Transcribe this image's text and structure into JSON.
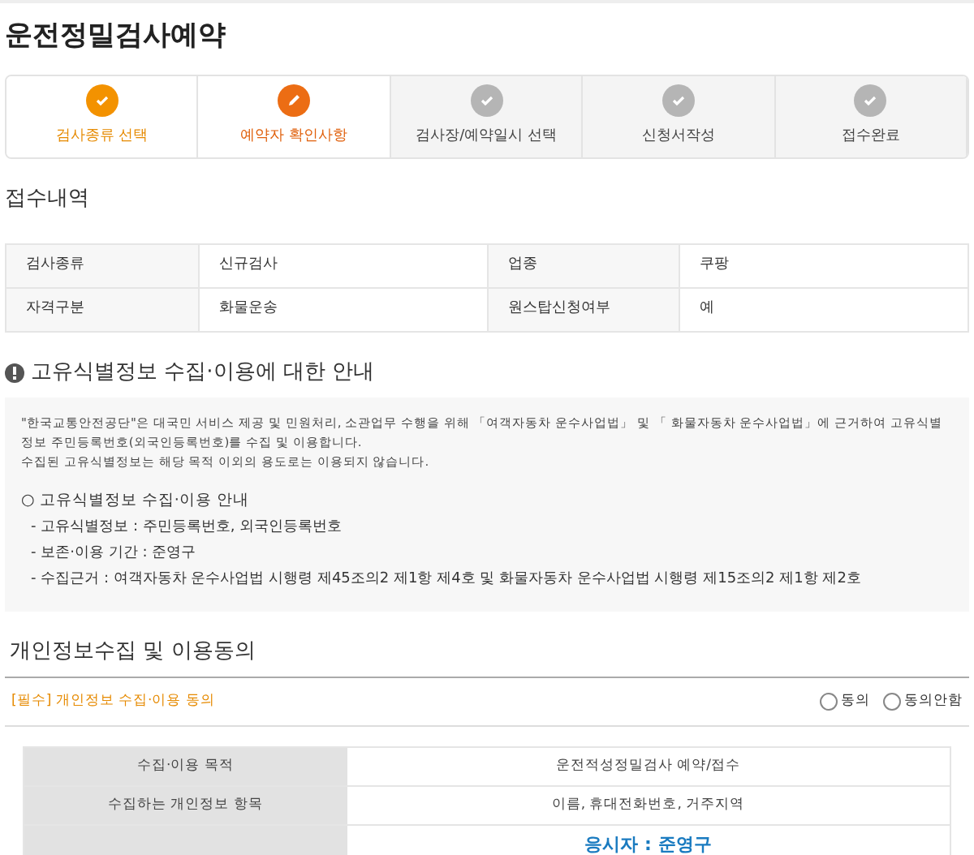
{
  "title": "운전정밀검사예약",
  "steps": [
    {
      "label": "검사종류 선택",
      "done": true,
      "selected": false
    },
    {
      "label": "예약자 확인사항",
      "done": false,
      "selected": true
    },
    {
      "label": "검사장/예약일시 선택",
      "done": false,
      "selected": false
    },
    {
      "label": "신청서작성",
      "done": false,
      "selected": false
    },
    {
      "label": "접수완료",
      "done": false,
      "selected": false
    }
  ],
  "receipt": {
    "heading": "접수내역",
    "rows": [
      [
        "검사종류",
        "신규검사",
        "업종",
        "쿠팡"
      ],
      [
        "자격구분",
        "화물운송",
        "원스탑신청여부",
        "예"
      ]
    ]
  },
  "notice": {
    "heading": "고유식별정보 수집·이용에 대한 안내",
    "paragraphs": [
      "\"한국교통안전공단\"은 대국민 서비스 제공 및 민원처리, 소관업무 수행을 위해 「여객자동차 운수사업법」 및 「 화물자동차 운수사업법」에 근거하여 고유식별정보 주민등록번호(외국인등록번호)를 수집 및 이용합니다.",
      "수집된 고유식별정보는 해당 목적 이외의 용도로는 이용되지 않습니다."
    ],
    "list_title": "○ 고유식별정보 수집·이용 안내",
    "items": [
      "- 고유식별정보 : 주민등록번호, 외국인등록번호",
      "- 보존·이용 기간 : 준영구",
      "- 수집근거 : 여객자동차 운수사업법 시행령 제45조의2 제1항 제4호 및 화물자동차 운수사업법 시행령 제15조의2 제1항 제2호"
    ]
  },
  "consent": {
    "heading": "개인정보수집 및 이용동의",
    "required_label": "[필수] 개인정보 수집·이용 동의",
    "options": [
      {
        "label": "동의",
        "selected": false
      },
      {
        "label": "동의안함",
        "selected": false
      }
    ],
    "rows": [
      {
        "label": "수집·이용 목적",
        "values": [
          "운전적성정밀검사 예약/접수"
        ],
        "emphasis": false
      },
      {
        "label": "수집하는 개인정보 항목",
        "values": [
          "이름, 휴대전화번호, 거주지역"
        ],
        "emphasis": false
      },
      {
        "values": [
          "응시자 : 준영구"
        ],
        "emphasis": true
      }
    ]
  }
}
